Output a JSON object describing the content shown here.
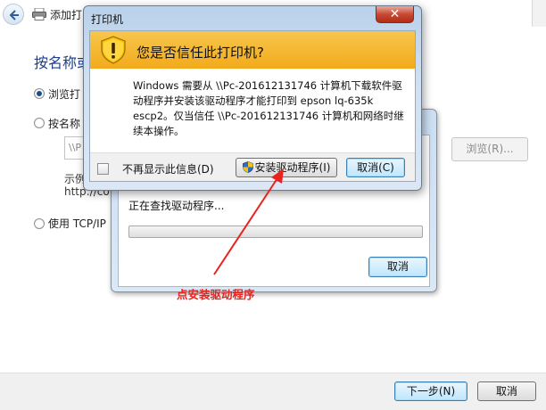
{
  "wizard": {
    "title": "添加打",
    "heading": "按名称或",
    "options": {
      "browse": "浏览打",
      "by_name": "按名称",
      "tcpip": "使用 TCP/IP"
    },
    "name_input_value": "\\\\P",
    "hint_label": "示例",
    "hint_url": "http://co",
    "browse_button": "浏览(R)...",
    "next_button": "下一步(N)",
    "cancel_button": "取消"
  },
  "progress_dialog": {
    "status_text": "正在查找驱动程序...",
    "progress_fraction": 0.0,
    "cancel_button": "取消"
  },
  "trust_dialog": {
    "title": "打印机",
    "close_glyph": "✕",
    "heading": "您是否信任此打印机?",
    "message_lines": [
      "Windows 需要从 \\\\Pc-201612131746 计算机下载软件驱",
      "动程序并安装该驱动程序才能打印到 epson lq-635k",
      "escp2。仅当信任 \\\\Pc-201612131746 计算机和网络时继",
      "续本操作。"
    ],
    "dont_show_label": "不再显示此信息(D)",
    "install_button": "安装驱动程序(I)",
    "cancel_button": "取消(C)"
  },
  "annotation": {
    "text": "点安装驱动程序",
    "color": "#e8231f"
  },
  "colors": {
    "warning_band": "#f4b429",
    "heading_blue": "#1a3e8c",
    "dialog_frame": "#cfe0f2"
  }
}
